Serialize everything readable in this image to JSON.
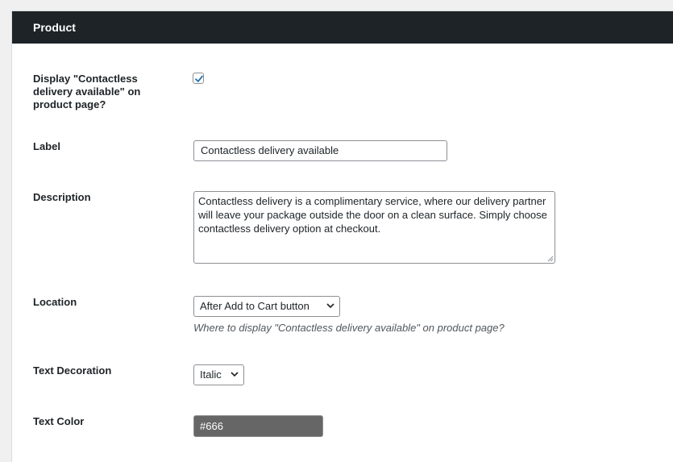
{
  "section": {
    "title": "Product"
  },
  "fields": {
    "display": {
      "label": "Display \"Contactless delivery available\" on product page?",
      "checked": true
    },
    "label": {
      "label": "Label",
      "value": "Contactless delivery available"
    },
    "description": {
      "label": "Description",
      "value": "Contactless delivery is a complimentary service, where our delivery partner will leave your package outside the door on a clean surface. Simply choose contactless delivery option at checkout."
    },
    "location": {
      "label": "Location",
      "selected": "After Add to Cart button",
      "help": "Where to display \"Contactless delivery available\" on product page?"
    },
    "text_decoration": {
      "label": "Text Decoration",
      "selected": "Italic"
    },
    "text_color": {
      "label": "Text Color",
      "value": "#666",
      "swatch": "#666666"
    }
  },
  "colors": {
    "header_bg": "#1d2327",
    "checkbox_accent": "#2271b1"
  }
}
